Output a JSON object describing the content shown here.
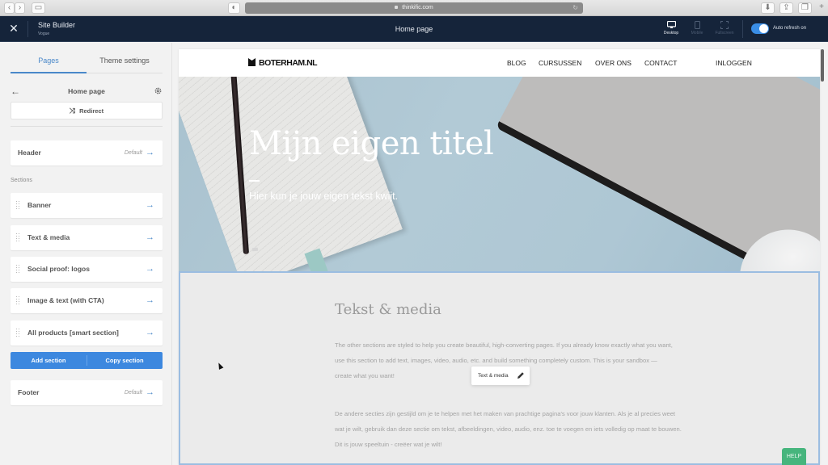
{
  "browser": {
    "url": "thinkific.com",
    "back_icon": "chevron-left",
    "forward_icon": "chevron-right",
    "new_tab_label": "+"
  },
  "topbar": {
    "close_icon": "✕",
    "app_title": "Site Builder",
    "theme_name": "Vogue",
    "current_page": "Home page",
    "devices": [
      {
        "label": "Desktop",
        "active": true
      },
      {
        "label": "Mobile",
        "active": false
      },
      {
        "label": "Fullscreen",
        "active": false
      }
    ],
    "auto_refresh_label": "Auto refresh on",
    "auto_refresh_on": true,
    "accent": "#3a8ee6"
  },
  "sidebar": {
    "tabs": [
      {
        "label": "Pages",
        "active": true
      },
      {
        "label": "Theme settings",
        "active": false
      }
    ],
    "back_icon": "←",
    "page_name": "Home page",
    "redirect_icon": "⤨",
    "redirect_label": "Redirect",
    "header": {
      "label": "Header",
      "tag": "Default",
      "arrow": "→"
    },
    "sections_label": "Sections",
    "sections": [
      {
        "label": "Banner",
        "arrow": "→"
      },
      {
        "label": "Text & media",
        "arrow": "→"
      },
      {
        "label": "Social proof: logos",
        "arrow": "→"
      },
      {
        "label": "Image & text (with CTA)",
        "arrow": "→"
      },
      {
        "label": "All products [smart section]",
        "arrow": "→"
      }
    ],
    "add_section_label": "Add section",
    "copy_section_label": "Copy section",
    "footer": {
      "label": "Footer",
      "tag": "Default",
      "arrow": "→"
    }
  },
  "preview": {
    "logo": "BOTERHAM.NL",
    "nav": [
      "BLOG",
      "CURSUSSEN",
      "OVER ONS",
      "CONTACT"
    ],
    "login": "INLOGGEN",
    "hero_title": "Mijn eigen titel",
    "hero_subtitle": "Hier kun je jouw eigen tekst kwijt.",
    "section_title": "Tekst & media",
    "paragraph_en": "The other sections are styled to help you create beautiful, high-converting pages. If you already know exactly what you want, use this section to add text, images, video, audio, etc. and build something completely custom. This is your sandbox — create what you want!",
    "paragraph_nl": "De andere secties zijn gestijld om je te helpen met het maken van prachtige pagina's voor jouw klanten. Als je al precies weet wat je wilt, gebruik dan deze sectie om tekst, afbeeldingen, video, audio, enz. toe te voegen en iets volledig op maat te bouwen. Dit is jouw speeltuin - creëer wat je wilt!",
    "section_tag_label": "Text & media",
    "selected_border_color": "#9bbde1"
  },
  "help_label": "HELP",
  "help_color": "#46b57d"
}
